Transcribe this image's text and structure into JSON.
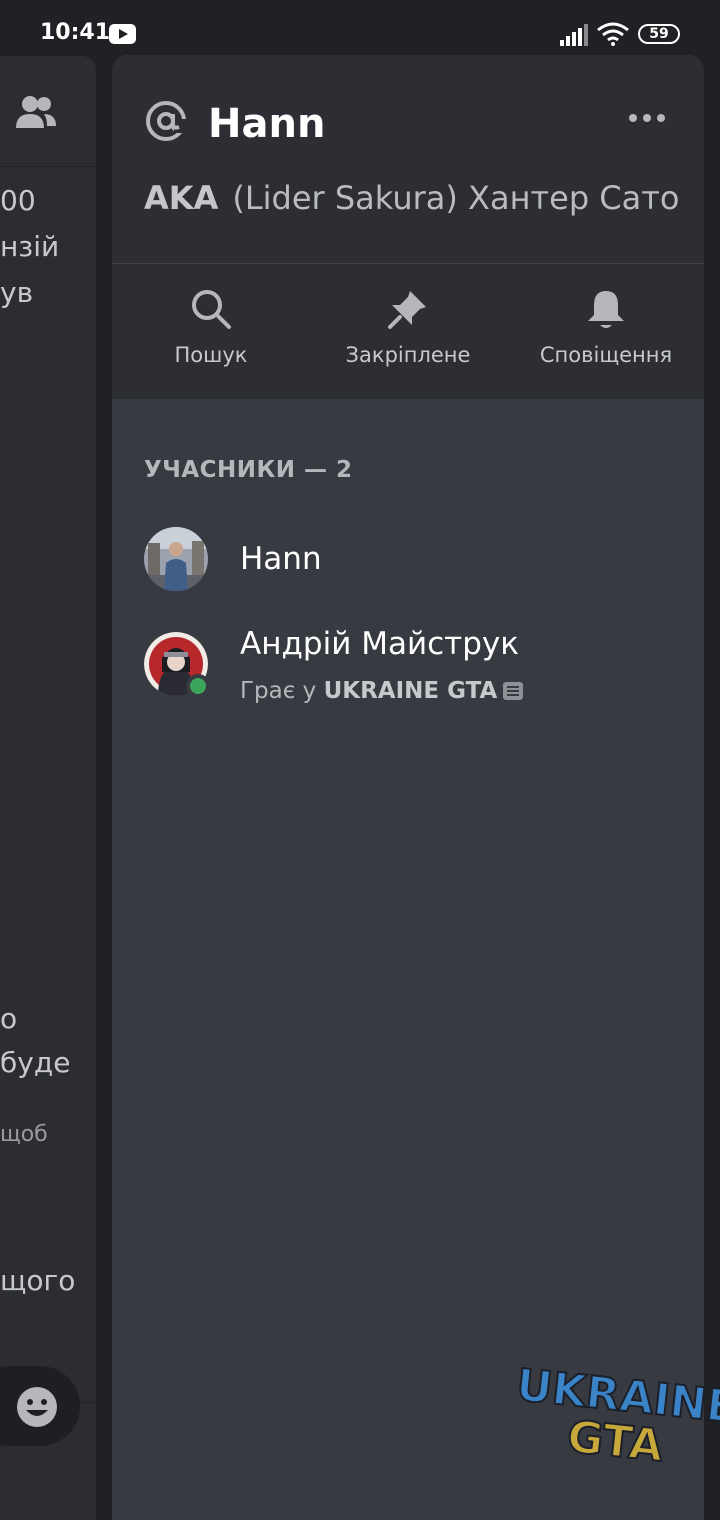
{
  "status_bar": {
    "time": "10:41",
    "battery": "59"
  },
  "background_panel": {
    "fragments": [
      "00",
      "нзій",
      "ув",
      "о",
      "буде",
      "щоб",
      "щого"
    ]
  },
  "dm": {
    "name": "Hann",
    "aka_label": "AKA",
    "aka_names": "(Lider Sakura) Хантер Сато"
  },
  "actions": [
    {
      "label": "Пошук",
      "icon": "search-icon"
    },
    {
      "label": "Закріплене",
      "icon": "pin-icon"
    },
    {
      "label": "Сповіщення",
      "icon": "bell-icon"
    }
  ],
  "members": {
    "title": "УЧАСНИКИ — 2",
    "list": [
      {
        "name": "Hann",
        "activity_prefix": "",
        "activity_game": "",
        "online": false
      },
      {
        "name": "Андрій Майструк",
        "activity_prefix": "Грає у ",
        "activity_game": "UKRAINE GTA",
        "online": true
      }
    ]
  },
  "watermark": {
    "line1": "UKRAINE",
    "line2": "GTA"
  },
  "colors": {
    "drawer_bg": "#373a41",
    "header_bg": "#2c2e33",
    "online": "#3ba55c"
  }
}
